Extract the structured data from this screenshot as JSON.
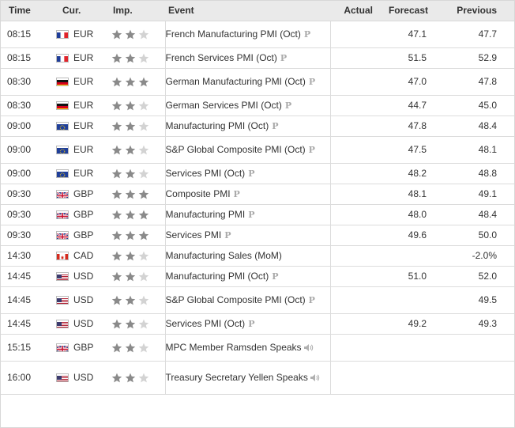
{
  "header": {
    "time": "Time",
    "cur": "Cur.",
    "imp": "Imp.",
    "event": "Event",
    "actual": "Actual",
    "forecast": "Forecast",
    "previous": "Previous"
  },
  "colors": {
    "star_filled": "#8a8a8a",
    "star_empty": "#d3d3d3",
    "header_bg": "#eaeaea",
    "border": "#dcdcdc"
  },
  "rows": [
    {
      "time": "08:15",
      "flag": "fr",
      "cur": "EUR",
      "stars": 2,
      "event": "French Manufacturing PMI (Oct)",
      "icon": "p",
      "actual": "",
      "forecast": "47.1",
      "previous": "47.7"
    },
    {
      "time": "08:15",
      "flag": "fr",
      "cur": "EUR",
      "stars": 2,
      "event": "French Services PMI (Oct)",
      "icon": "p",
      "actual": "",
      "forecast": "51.5",
      "previous": "52.9"
    },
    {
      "time": "08:30",
      "flag": "de",
      "cur": "EUR",
      "stars": 3,
      "event": "German Manufacturing PMI (Oct)",
      "icon": "p",
      "actual": "",
      "forecast": "47.0",
      "previous": "47.8"
    },
    {
      "time": "08:30",
      "flag": "de",
      "cur": "EUR",
      "stars": 2,
      "event": "German Services PMI (Oct)",
      "icon": "p",
      "actual": "",
      "forecast": "44.7",
      "previous": "45.0"
    },
    {
      "time": "09:00",
      "flag": "eu",
      "cur": "EUR",
      "stars": 2,
      "event": "Manufacturing PMI (Oct)",
      "icon": "p",
      "actual": "",
      "forecast": "47.8",
      "previous": "48.4"
    },
    {
      "time": "09:00",
      "flag": "eu",
      "cur": "EUR",
      "stars": 2,
      "event": "S&P Global Composite PMI (Oct)",
      "icon": "p",
      "actual": "",
      "forecast": "47.5",
      "previous": "48.1"
    },
    {
      "time": "09:00",
      "flag": "eu",
      "cur": "EUR",
      "stars": 2,
      "event": "Services PMI (Oct)",
      "icon": "p",
      "actual": "",
      "forecast": "48.2",
      "previous": "48.8"
    },
    {
      "time": "09:30",
      "flag": "gb",
      "cur": "GBP",
      "stars": 3,
      "event": "Composite PMI",
      "icon": "p",
      "actual": "",
      "forecast": "48.1",
      "previous": "49.1"
    },
    {
      "time": "09:30",
      "flag": "gb",
      "cur": "GBP",
      "stars": 3,
      "event": "Manufacturing PMI",
      "icon": "p",
      "actual": "",
      "forecast": "48.0",
      "previous": "48.4"
    },
    {
      "time": "09:30",
      "flag": "gb",
      "cur": "GBP",
      "stars": 3,
      "event": "Services PMI",
      "icon": "p",
      "actual": "",
      "forecast": "49.6",
      "previous": "50.0"
    },
    {
      "time": "14:30",
      "flag": "ca",
      "cur": "CAD",
      "stars": 2,
      "event": "Manufacturing Sales (MoM)",
      "icon": "",
      "actual": "",
      "forecast": "",
      "previous": "-2.0%"
    },
    {
      "time": "14:45",
      "flag": "us",
      "cur": "USD",
      "stars": 2,
      "event": "Manufacturing PMI (Oct)",
      "icon": "p",
      "actual": "",
      "forecast": "51.0",
      "previous": "52.0"
    },
    {
      "time": "14:45",
      "flag": "us",
      "cur": "USD",
      "stars": 2,
      "event": "S&P Global Composite PMI (Oct)",
      "icon": "p",
      "actual": "",
      "forecast": "",
      "previous": "49.5"
    },
    {
      "time": "14:45",
      "flag": "us",
      "cur": "USD",
      "stars": 2,
      "event": "Services PMI (Oct)",
      "icon": "p",
      "actual": "",
      "forecast": "49.2",
      "previous": "49.3"
    },
    {
      "time": "15:15",
      "flag": "gb",
      "cur": "GBP",
      "stars": 2,
      "event": "MPC Member Ramsden Speaks",
      "icon": "speaker",
      "actual": "",
      "forecast": "",
      "previous": ""
    },
    {
      "time": "16:00",
      "flag": "us",
      "cur": "USD",
      "stars": 2,
      "event": "Treasury Secretary Yellen Speaks",
      "icon": "speaker",
      "actual": "",
      "forecast": "",
      "previous": ""
    }
  ]
}
